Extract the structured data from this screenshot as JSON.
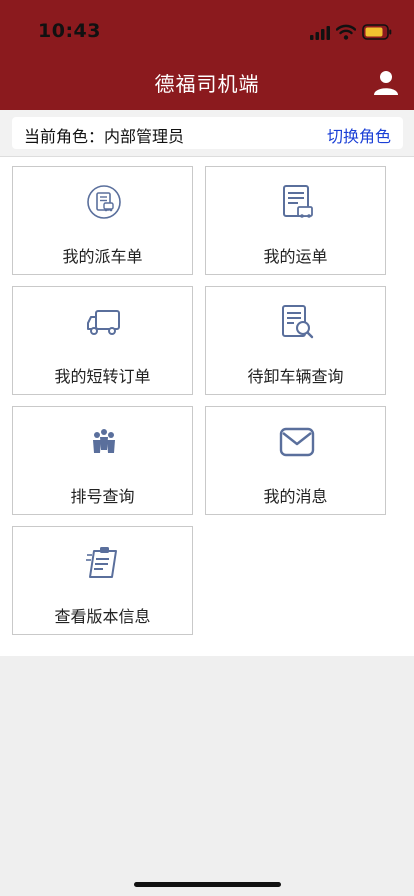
{
  "status": {
    "time": "10:43"
  },
  "header": {
    "title": "德福司机端"
  },
  "role": {
    "text": "当前角色：内部管理员",
    "switch_label": "切换角色"
  },
  "menu": [
    {
      "label": "我的派车单",
      "icon": "dispatch-order-icon"
    },
    {
      "label": "我的运单",
      "icon": "waybill-icon"
    },
    {
      "label": "我的短转订单",
      "icon": "truck-icon"
    },
    {
      "label": "待卸车辆查询",
      "icon": "document-search-icon"
    },
    {
      "label": "排号查询",
      "icon": "queue-people-icon"
    },
    {
      "label": "我的消息",
      "icon": "envelope-icon"
    },
    {
      "label": "查看版本信息",
      "icon": "clipboard-icon"
    }
  ],
  "colors": {
    "header": "#8b1a1e",
    "accent": "#1a3fd6",
    "icon": "#5a6f9c"
  }
}
